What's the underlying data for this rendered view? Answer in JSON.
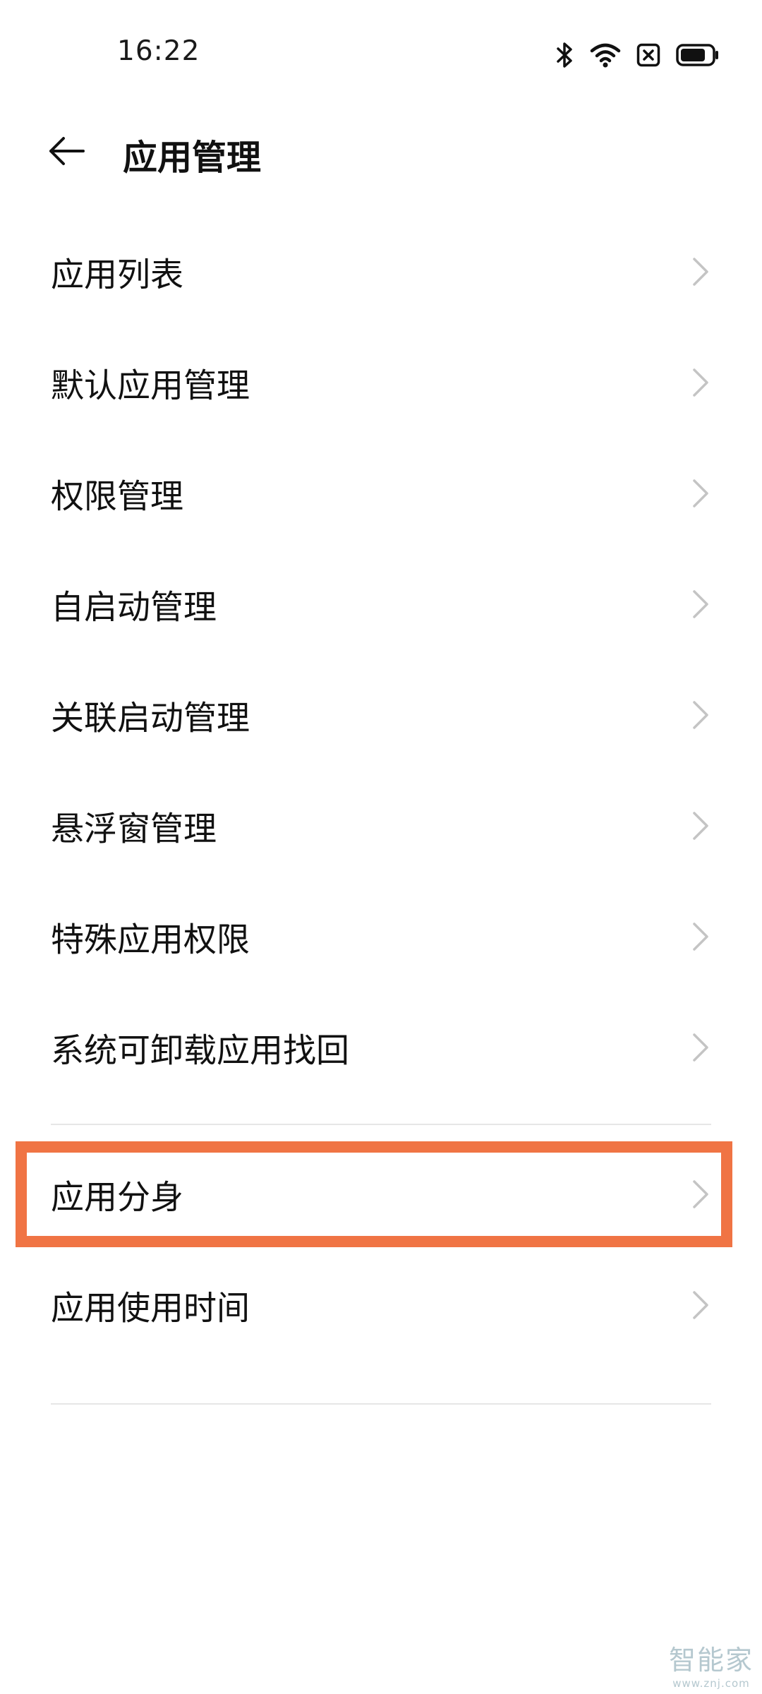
{
  "status_bar": {
    "time": "16:22",
    "icons": [
      "bluetooth-icon",
      "wifi-icon",
      "sim-disabled-icon",
      "battery-icon"
    ]
  },
  "header": {
    "back_icon": "arrow-left-icon",
    "title": "应用管理"
  },
  "list": {
    "items": [
      {
        "label": "应用列表"
      },
      {
        "label": "默认应用管理"
      },
      {
        "label": "权限管理"
      },
      {
        "label": "自启动管理"
      },
      {
        "label": "关联启动管理"
      },
      {
        "label": "悬浮窗管理"
      },
      {
        "label": "特殊应用权限"
      },
      {
        "label": "系统可卸载应用找回"
      },
      {
        "label": "应用分身",
        "highlighted": true
      },
      {
        "label": "应用使用时间"
      }
    ],
    "chevron_icon": "chevron-right-icon"
  },
  "colors": {
    "highlight": "#f07444",
    "divider": "#e6e6e6",
    "chevron": "#c4c4c4",
    "watermark": "#b5c8cf"
  },
  "watermark": {
    "logo": "智能家",
    "url": "www.znj.com"
  }
}
